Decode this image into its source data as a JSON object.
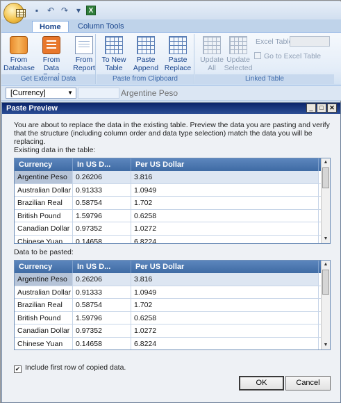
{
  "qat": {
    "items": [
      "save-icon",
      "undo-icon",
      "redo-icon",
      "customize-icon",
      "excel-icon"
    ]
  },
  "tabs": [
    {
      "label": "Home"
    },
    {
      "label": "Column Tools"
    }
  ],
  "ribbon": {
    "groups": {
      "external": {
        "label": "Get External Data",
        "buttons": [
          {
            "line1": "From",
            "line2": "Database"
          },
          {
            "line1": "From",
            "line2": "Data Feed"
          },
          {
            "line1": "From",
            "line2": "Report"
          }
        ]
      },
      "clipboard": {
        "label": "Paste from Clipboard",
        "buttons": [
          {
            "line1": "To New",
            "line2": "Table"
          },
          {
            "line1": "Paste",
            "line2": "Append"
          },
          {
            "line1": "Paste",
            "line2": "Replace"
          }
        ]
      },
      "linked": {
        "label": "Linked Table",
        "buttons": [
          {
            "line1": "Update",
            "line2": "All"
          },
          {
            "line1": "Update",
            "line2": "Selected"
          }
        ],
        "excel_table_label": "Excel Table:",
        "goto_excel_label": "Go to Excel Table"
      }
    }
  },
  "formula_bar": {
    "name_box": "[Currency]",
    "value": "Argentine Peso"
  },
  "dialog": {
    "title": "Paste Preview",
    "message": "You are about to replace the data in the existing table. Preview the data you are pasting and verify that the structure (including column order and data type selection) match the data you will be replacing.",
    "existing_label": "Existing data in the table:",
    "pasted_label": "Data to be pasted:",
    "columns": [
      "Currency",
      "In US D...",
      "Per US Dollar"
    ],
    "existing_rows": [
      [
        "Argentine Peso",
        "0.26206",
        "3.816"
      ],
      [
        "Australian Dollar",
        "0.91333",
        "1.0949"
      ],
      [
        "Brazilian Real",
        "0.58754",
        "1.702"
      ],
      [
        "British Pound",
        "1.59796",
        "0.6258"
      ],
      [
        "Canadian Dollar",
        "0.97352",
        "1.0272"
      ],
      [
        "Chinese Yuan",
        "0.14658",
        "6.8224"
      ]
    ],
    "pasted_rows": [
      [
        "Argentine Peso",
        "0.26206",
        "3.816"
      ],
      [
        "Australian Dollar",
        "0.91333",
        "1.0949"
      ],
      [
        "Brazilian Real",
        "0.58754",
        "1.702"
      ],
      [
        "British Pound",
        "1.59796",
        "0.6258"
      ],
      [
        "Canadian Dollar",
        "0.97352",
        "1.0272"
      ],
      [
        "Chinese Yuan",
        "0.14658",
        "6.8224"
      ]
    ],
    "include_first_row_label": "Include first row of copied data.",
    "include_first_row_checked": true,
    "ok_label": "OK",
    "cancel_label": "Cancel"
  }
}
